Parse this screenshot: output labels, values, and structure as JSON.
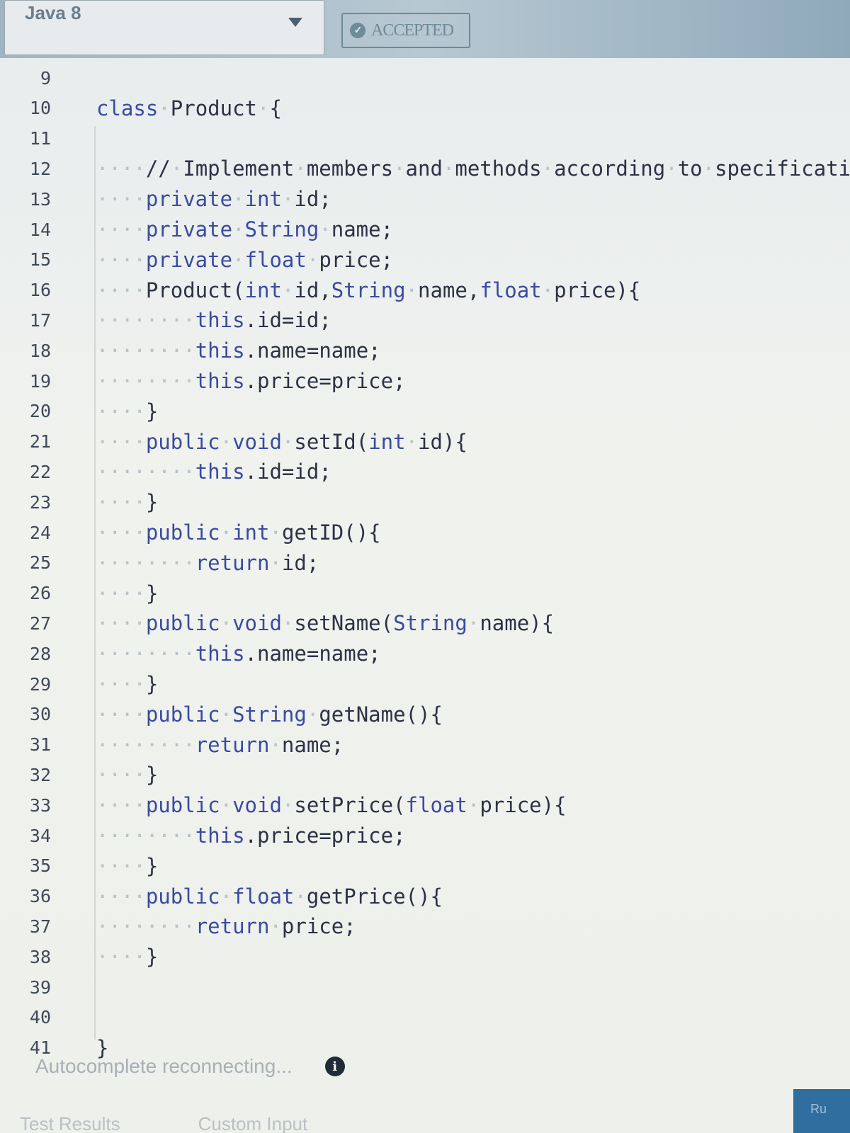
{
  "header": {
    "language_label": "Java 8",
    "status_label": "ACCEPTED",
    "status_icon": "check-circle-icon"
  },
  "editor": {
    "lines": [
      {
        "num": "9",
        "text": ""
      },
      {
        "num": "10",
        "text": "class·Product·{"
      },
      {
        "num": "11",
        "text": ""
      },
      {
        "num": "12",
        "text": "····//·Implement·members·and·methods·according·to·specificatio"
      },
      {
        "num": "13",
        "text": "····private·int·id;"
      },
      {
        "num": "14",
        "text": "····private·String·name;"
      },
      {
        "num": "15",
        "text": "····private·float·price;"
      },
      {
        "num": "16",
        "text": "····Product(int·id,String·name,float·price){"
      },
      {
        "num": "17",
        "text": "········this.id=id;"
      },
      {
        "num": "18",
        "text": "········this.name=name;"
      },
      {
        "num": "19",
        "text": "········this.price=price;"
      },
      {
        "num": "20",
        "text": "····}"
      },
      {
        "num": "21",
        "text": "····public·void·setId(int·id){"
      },
      {
        "num": "22",
        "text": "········this.id=id;"
      },
      {
        "num": "23",
        "text": "····}"
      },
      {
        "num": "24",
        "text": "····public·int·getID(){"
      },
      {
        "num": "25",
        "text": "········return·id;"
      },
      {
        "num": "26",
        "text": "····}"
      },
      {
        "num": "27",
        "text": "····public·void·setName(String·name){"
      },
      {
        "num": "28",
        "text": "········this.name=name;"
      },
      {
        "num": "29",
        "text": "····}"
      },
      {
        "num": "30",
        "text": "····public·String·getName(){"
      },
      {
        "num": "31",
        "text": "········return·name;"
      },
      {
        "num": "32",
        "text": "····}"
      },
      {
        "num": "33",
        "text": "····public·void·setPrice(float·price){"
      },
      {
        "num": "34",
        "text": "········this.price=price;"
      },
      {
        "num": "35",
        "text": "····}"
      },
      {
        "num": "36",
        "text": "····public·float·getPrice(){"
      },
      {
        "num": "37",
        "text": "········return·price;"
      },
      {
        "num": "38",
        "text": "····}"
      },
      {
        "num": "39",
        "text": ""
      },
      {
        "num": "40",
        "text": ""
      },
      {
        "num": "41",
        "text": "}"
      }
    ]
  },
  "footer": {
    "autocomplete_status": "Autocomplete reconnecting...",
    "info_icon": "info-icon",
    "tabs": [
      "Test Results",
      "Custom Input"
    ],
    "run_label": "Ru"
  }
}
